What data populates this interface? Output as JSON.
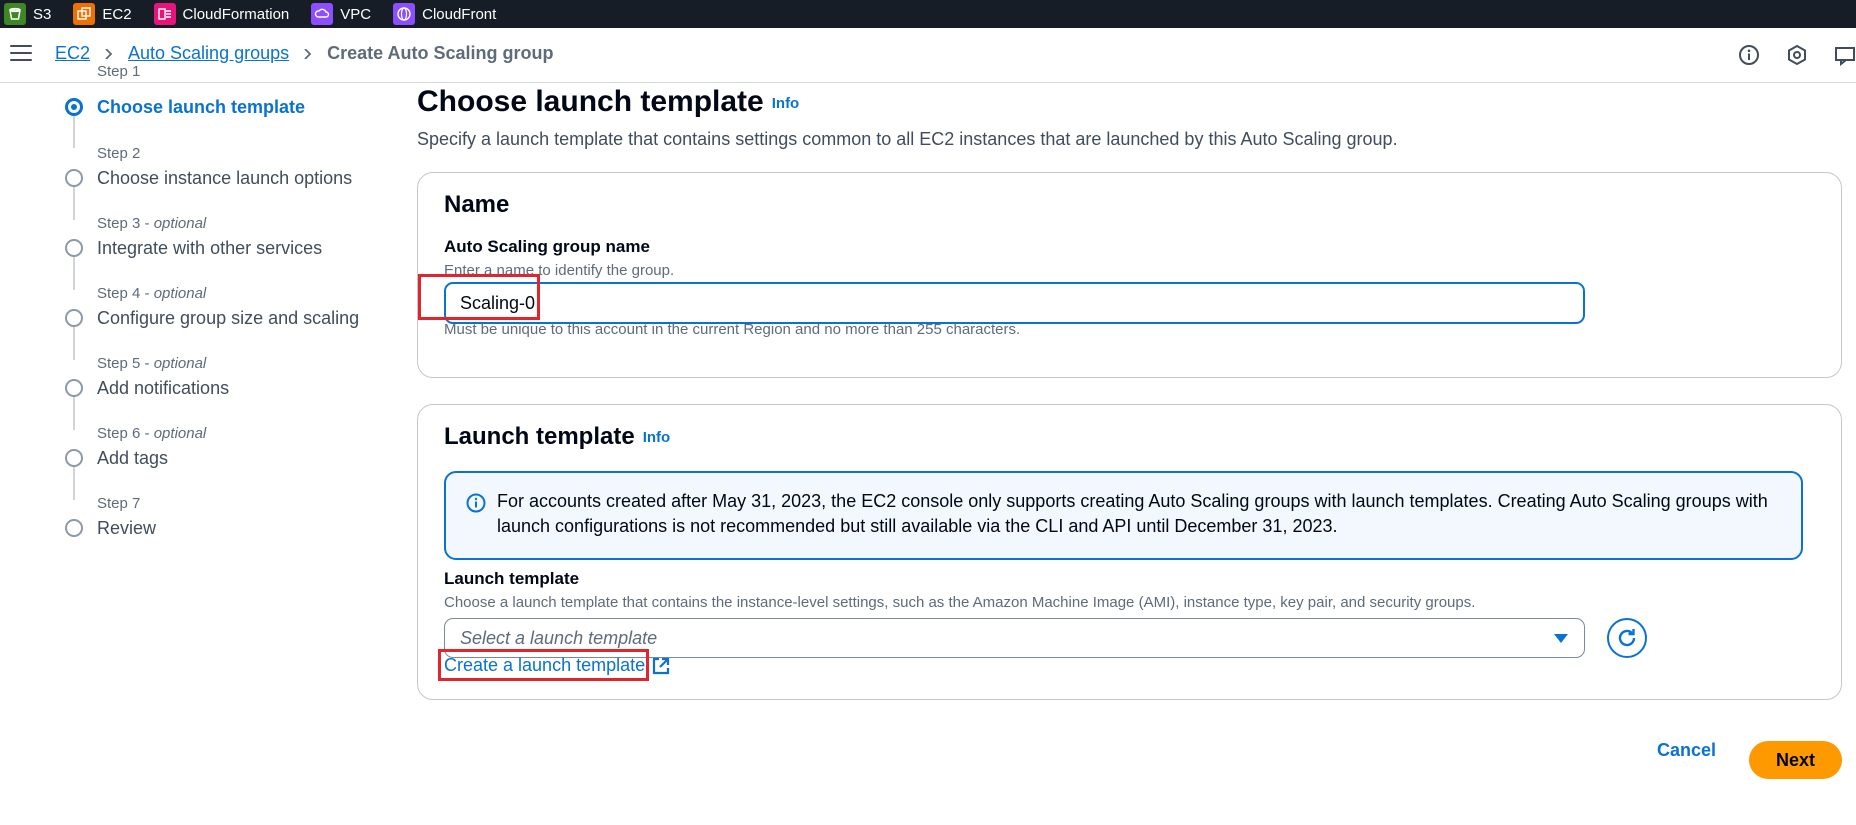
{
  "favorites": [
    {
      "label": "S3",
      "icon": "s3-icon",
      "color": "#3f8624"
    },
    {
      "label": "EC2",
      "icon": "ec2-icon",
      "color": "#ed7100"
    },
    {
      "label": "CloudFormation",
      "icon": "cloudformation-icon",
      "color": "#e7157b"
    },
    {
      "label": "VPC",
      "icon": "vpc-icon",
      "color": "#8c4fff"
    },
    {
      "label": "CloudFront",
      "icon": "cloudfront-icon",
      "color": "#8c4fff"
    }
  ],
  "breadcrumb": {
    "items": [
      "EC2",
      "Auto Scaling groups"
    ],
    "current": "Create Auto Scaling group"
  },
  "steps": [
    {
      "num": "Step 1",
      "optional": "",
      "label": "Choose launch template",
      "active": true
    },
    {
      "num": "Step 2",
      "optional": "",
      "label": "Choose instance launch options",
      "active": false
    },
    {
      "num": "Step 3",
      "optional": "optional",
      "label": "Integrate with other services",
      "active": false
    },
    {
      "num": "Step 4",
      "optional": "optional",
      "label": "Configure group size and scaling",
      "active": false
    },
    {
      "num": "Step 5",
      "optional": "optional",
      "label": "Add notifications",
      "active": false
    },
    {
      "num": "Step 6",
      "optional": "optional",
      "label": "Add tags",
      "active": false
    },
    {
      "num": "Step 7",
      "optional": "",
      "label": "Review",
      "active": false
    }
  ],
  "main": {
    "title": "Choose launch template",
    "info": "Info",
    "description": "Specify a launch template that contains settings common to all EC2 instances that are launched by this Auto Scaling group."
  },
  "name_card": {
    "heading": "Name",
    "field_label": "Auto Scaling group name",
    "field_desc": "Enter a name to identify the group.",
    "value": "Scaling-0",
    "constraint": "Must be unique to this account in the current Region and no more than 255 characters."
  },
  "template_card": {
    "heading": "Launch template",
    "info": "Info",
    "alert": "For accounts created after May 31, 2023, the EC2 console only supports creating Auto Scaling groups with launch templates. Creating Auto Scaling groups with launch configurations is not recommended but still available via the CLI and API until December 31, 2023.",
    "field_label": "Launch template",
    "field_desc": "Choose a launch template that contains the instance-level settings, such as the Amazon Machine Image (AMI), instance type, key pair, and security groups.",
    "select_placeholder": "Select a launch template",
    "create_link": "Create a launch template"
  },
  "footer": {
    "cancel": "Cancel",
    "next": "Next"
  },
  "colors": {
    "accent": "#0972d3",
    "primary_button": "#ff9900",
    "highlight": "#e0262c"
  }
}
